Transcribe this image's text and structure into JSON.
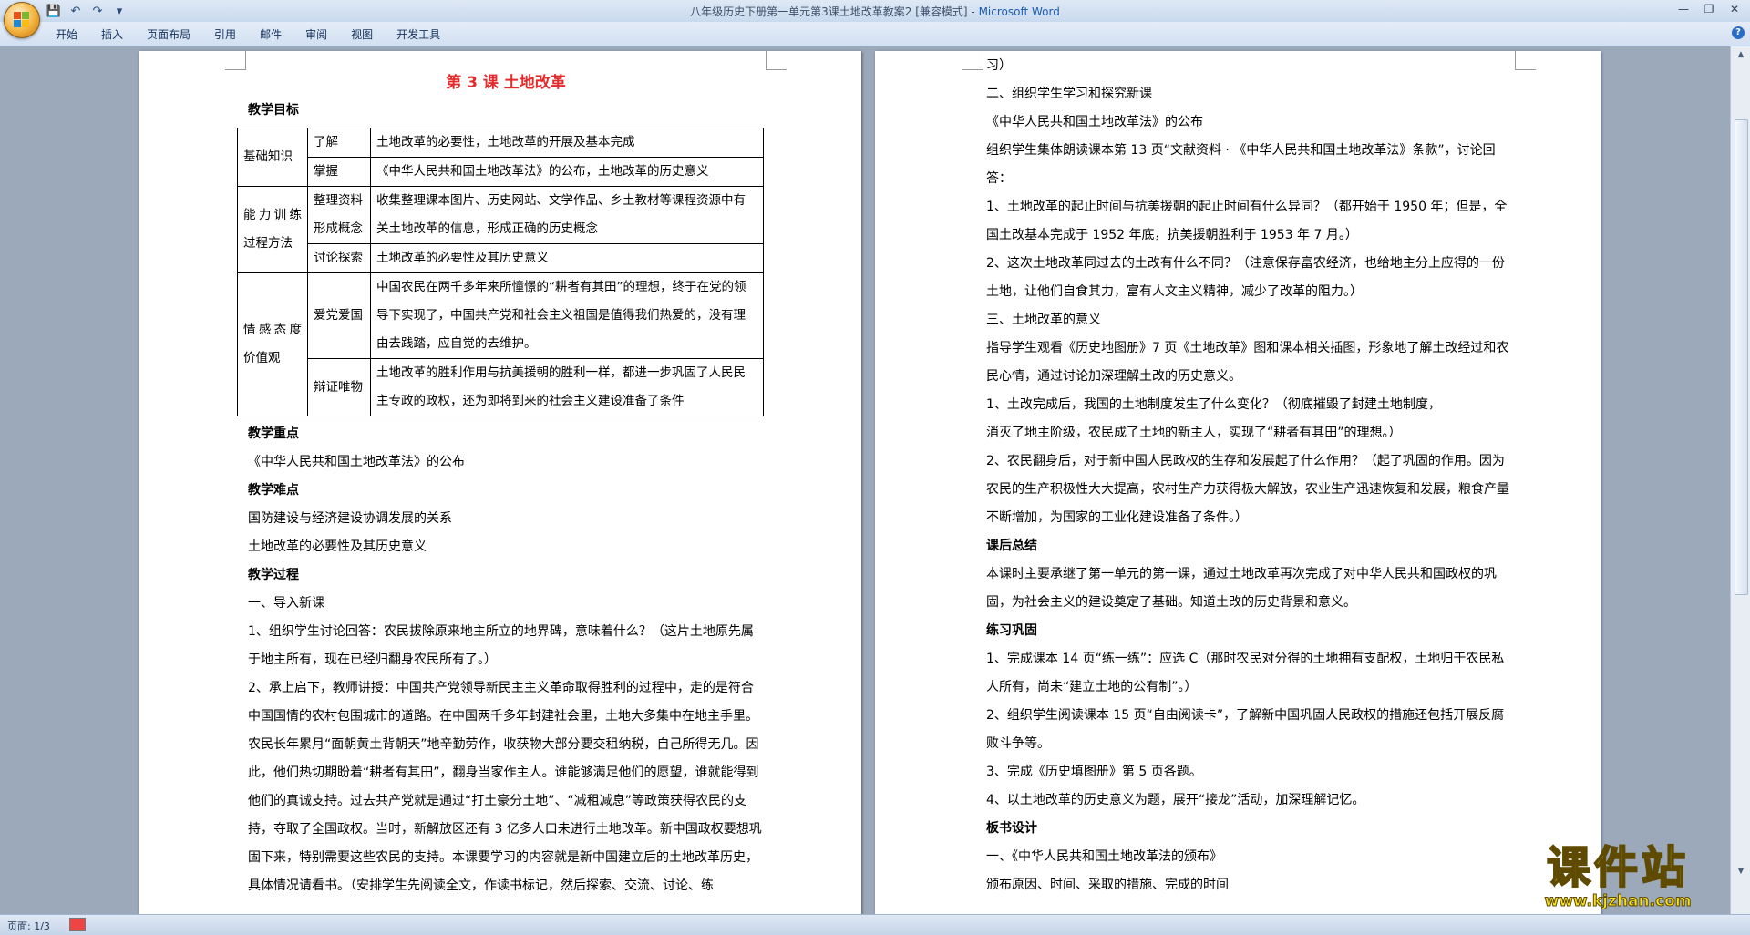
{
  "window": {
    "title": "八年级历史下册第一单元第3课土地改革教案2 [兼容模式] - ",
    "app_name": "Microsoft Word",
    "controls": [
      "—",
      "❐",
      "✕"
    ]
  },
  "quick_access": [
    "save-icon",
    "undo-icon",
    "redo-icon",
    "customize-icon"
  ],
  "ribbon": {
    "tabs": [
      "开始",
      "插入",
      "页面布局",
      "引用",
      "邮件",
      "审阅",
      "视图",
      "开发工具"
    ],
    "help": "?"
  },
  "page1": {
    "lesson_title": "第 3 课  土地改革",
    "objectives_heading": "教学目标",
    "table": {
      "basic_knowledge": "基础知识",
      "understand_label": "了解",
      "understand_text": "土地改革的必要性，土地改革的开展及基本完成",
      "master_label": "掌握",
      "master_text": "《中华人民共和国土地改革法》的公布，土地改革的历史意义",
      "ability_process": "能力训练过程方法",
      "organize_label": "整理资料形成概念",
      "organize_text": "收集整理课本图片、历史网站、文学作品、乡土教材等课程资源中有关土地改革的信息，形成正确的历史概念",
      "discuss_label": "讨论探索",
      "discuss_text": "土地改革的必要性及其历史意义",
      "emotion_values": "情感态度价值观",
      "patriotism_label": "爱党爱国",
      "patriotism_text": "中国农民在两千多年来所憧憬的“耕者有其田”的理想，终于在党的领导下实现了，中国共产党和社会主义祖国是值得我们热爱的，没有理由去践踏，应自觉的去维护。",
      "dialectic_label": "辩证唯物",
      "dialectic_text": "土地改革的胜利作用与抗美援朝的胜利一样，都进一步巩固了人民民主专政的政权，还为即将到来的社会主义建设准备了条件"
    },
    "focus_heading": "教学重点",
    "focus_text": "《中华人民共和国土地改革法》的公布",
    "difficulty_heading": "教学难点",
    "difficulty_1": " 国防建设与经济建设协调发展的关系",
    "difficulty_2": "土地改革的必要性及其历史意义",
    "process_heading": "教学过程",
    "intro": "一、导入新课",
    "intro_1": "1、组织学生讨论回答：农民拔除原来地主所立的地界碑，意味着什么？（这片土地原先属于地主所有，现在已经归翻身农民所有了。）",
    "intro_2": "2、承上启下，教师讲授：中国共产党领导新民主主义革命取得胜利的过程中，走的是符合中国国情的农村包围城市的道路。在中国两千多年封建社会里，土地大多集中在地主手里。农民长年累月“面朝黄土背朝天”地辛勤劳作，收获物大部分要交租纳税，自己所得无几。因此，他们热切期盼着“耕者有其田”，翻身当家作主人。谁能够满足他们的愿望，谁就能得到他们的真诚支持。过去共产党就是通过“打土豪分土地”、“减租减息”等政策获得农民的支持，夺取了全国政权。当时，新解放区还有 3 亿多人口未进行土地改革。新中国政权要想巩固下来，特别需要这些农民的支持。本课要学习的内容就是新中国建立后的土地改革历史，具体情况请看书。（安排学生先阅读全文，作读书标记，然后探索、交流、讨论、练"
  },
  "page2": {
    "cont": "习）",
    "sec2": "二、组织学生学习和探究新课",
    "law": "《中华人民共和国土地改革法》的公布",
    "read": "组织学生集体朗读课本第 13 页“文献资料 · 《中华人民共和国土地改革法》条款”，讨论回答：",
    "q1": "1、土地改革的起止时间与抗美援朝的起止时间有什么异同？（都开始于 1950 年；但是，全国土改基本完成于 1952 年底，抗美援朝胜利于 1953 年 7 月。）",
    "q2": "2、这次土地改革同过去的土改有什么不同？（注意保存富农经济，也给地主分上应得的一份土地，让他们自食其力，富有人文主义精神，减少了改革的阻力。）",
    "sec3": "三、土地改革的意义",
    "guide": "指导学生观看《历史地图册》7 页《土地改革》图和课本相关插图，形象地了解土改经过和农民心情，通过讨论加深理解土改的历史意义。",
    "q3a": "1、土改完成后，我国的土地制度发生了什么变化？（彻底摧毁了封建土地制度，",
    "q3b": "消灭了地主阶级，农民成了土地的新主人，实现了“耕者有其田”的理想。）",
    "q4": "2、农民翻身后，对于新中国人民政权的生存和发展起了什么作用？（起了巩固的作用。因为农民的生产积极性大大提高，农村生产力获得极大解放，农业生产迅速恢复和发展，粮食产量不断增加，为国家的工业化建设准备了条件。）",
    "summary_heading": "课后总结",
    "summary": "本课时主要承继了第一单元的第一课，通过土地改革再次完成了对中华人民共和国政权的巩固，为社会主义的建设奠定了基础。知道土改的历史背景和意义。",
    "practice_heading": "练习巩固",
    "p1": "1、完成课本 14 页“练一练”：应选 C（那时农民对分得的土地拥有支配权，土地归于农民私人所有，尚未“建立土地的公有制”。）",
    "p2": "2、组织学生阅读课本 15 页“自由阅读卡”，了解新中国巩固人民政权的措施还包括开展反腐败斗争等。",
    "p3": "3、完成《历史填图册》第 5 页各题。",
    "p4": "4、以土地改革的历史意义为题，展开“接龙”活动，加深理解记忆。",
    "board_heading": "板书设计",
    "b1": "一、《中华人民共和国土地改革法的颁布》",
    "b2": "颁布原因、时间、采取的措施、完成的时间"
  },
  "status": {
    "page": "页面: 1/3"
  },
  "watermark": {
    "name": "课件站",
    "url": "www.kjzhan.com"
  }
}
